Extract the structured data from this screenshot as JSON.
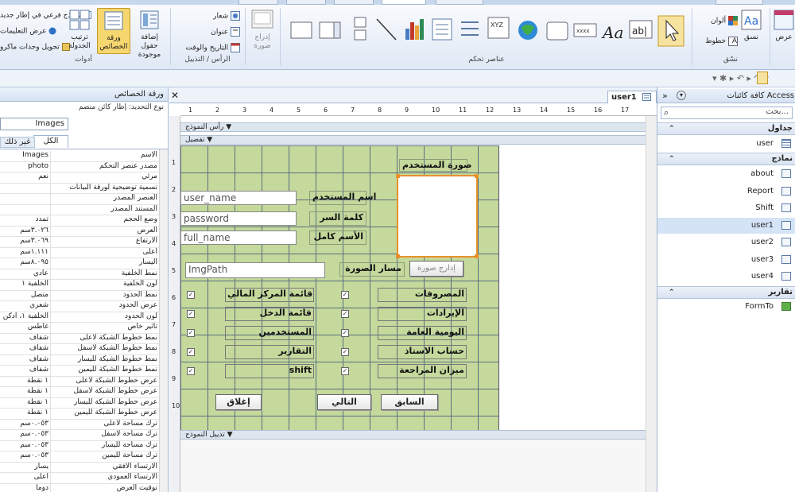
{
  "ribbon": {
    "groups": {
      "tools": "أدوات",
      "controls": "عناصر تحكم",
      "header_footer": "الرأس / التذييل",
      "format": "نسّق"
    },
    "buttons": {
      "subform_in_new_window": "نموذج فرعي في إطار جديد",
      "show_help": "عرض التعليمات",
      "convert_macros": "تحويل وحدات ماكرو",
      "tab_order": "ترتيب الجدولة",
      "property_sheet": "ورقة الخصائص",
      "add_existing_fields": "إضافة حقول موجودة",
      "logo": "شعار",
      "title": "عنوان",
      "date_time": "التاريخ والوقت",
      "insert_image": "إدراج صورة",
      "colors": "ألوان",
      "fonts": "خطوط",
      "themes": "نسق",
      "view": "عرض"
    },
    "active_color": "#f6d66e"
  },
  "properties": {
    "title": "ورقة الخصائص",
    "selection_type_label": "نوع التحديد: إطار كائن منضم",
    "selected_object": "Images",
    "tabs": [
      "الكل",
      "غير ذلك"
    ],
    "rows": [
      {
        "name": "الاسم",
        "value": "Images"
      },
      {
        "name": "مصدر عنصر التحكم",
        "value": "photo"
      },
      {
        "name": "مرئي",
        "value": "نعم"
      },
      {
        "name": "تسمية توضيحية لورقة البيانات",
        "value": ""
      },
      {
        "name": "العنصر المصدر",
        "value": ""
      },
      {
        "name": "المستند المصدر",
        "value": ""
      },
      {
        "name": "وضع الحجم",
        "value": "تمدد"
      },
      {
        "name": "العرض",
        "value": "٣.٠٢٦سم"
      },
      {
        "name": "الارتفاع",
        "value": "٣.٠٦٩سم"
      },
      {
        "name": "أعلى",
        "value": "١.١١١سم"
      },
      {
        "name": "اليسار",
        "value": "٨.٠٩٥سم"
      },
      {
        "name": "نمط الخلفية",
        "value": "عادي"
      },
      {
        "name": "لون الخلفية",
        "value": "الخلفية ١"
      },
      {
        "name": "نمط الحدود",
        "value": "متصل"
      },
      {
        "name": "عرض الحدود",
        "value": "شعري"
      },
      {
        "name": "لون الحدود",
        "value": "الخلفية ١، أدكن"
      },
      {
        "name": "تأثير خاص",
        "value": "غاطس"
      },
      {
        "name": "نمط خطوط الشبكة لأعلى",
        "value": "شفاف"
      },
      {
        "name": "نمط خطوط الشبكة لأسفل",
        "value": "شفاف"
      },
      {
        "name": "نمط خطوط الشبكة لليسار",
        "value": "شفاف"
      },
      {
        "name": "نمط خطوط الشبكة لليمين",
        "value": "شفاف"
      },
      {
        "name": "عرض خطوط الشبكة لأعلى",
        "value": "١ نقطة"
      },
      {
        "name": "عرض خطوط الشبكة لأسفل",
        "value": "١ نقطة"
      },
      {
        "name": "عرض خطوط الشبكة لليسار",
        "value": "١ نقطة"
      },
      {
        "name": "عرض خطوط الشبكة لليمين",
        "value": "١ نقطة"
      },
      {
        "name": "ترك مساحة لأعلى",
        "value": "٠.٠٥٣سم"
      },
      {
        "name": "ترك مساحة لأسفل",
        "value": "٠.٠٥٣سم"
      },
      {
        "name": "ترك مساحة لليسار",
        "value": "٠.٠٥٣سم"
      },
      {
        "name": "ترك مساحة لليمين",
        "value": "٠.٠٥٣سم"
      },
      {
        "name": "الارتساء الأفقي",
        "value": "يسار"
      },
      {
        "name": "الارتساء العمودي",
        "value": "أعلى"
      },
      {
        "name": "توقيت العرض",
        "value": "دوماً"
      }
    ]
  },
  "design": {
    "doc_tab": "user1",
    "sections": {
      "header": "رأس النموذج",
      "detail": "تفصيل",
      "footer": "تذييل النموذج"
    },
    "ruler_numbers": [
      "1",
      "2",
      "3",
      "4",
      "5",
      "6",
      "7",
      "8",
      "9",
      "10",
      "11",
      "12",
      "13",
      "14",
      "15",
      "16",
      "17"
    ],
    "vruler_numbers": [
      "1",
      "2",
      "3",
      "4",
      "5",
      "6",
      "7",
      "8",
      "9",
      "10"
    ],
    "form": {
      "image_label": "صورة المستخدم",
      "fields": [
        {
          "label": "اسم المستخدم",
          "value": "user_name"
        },
        {
          "label": "كلمة السر",
          "value": "password"
        },
        {
          "label": "الأسم كامل",
          "value": "full_name"
        }
      ],
      "imgpath_label": "مسار الصورة",
      "imgpath_value": "ImgPath",
      "insert_image_button": "إدارج صورة",
      "right_checks": [
        "المصروفات",
        "الإيرادات",
        "اليومية العامة",
        "حساب الاستاذ",
        "ميزان المراجعة"
      ],
      "left_checks": [
        "قائمة المركز المالي",
        "قائمة الدخل",
        "المستخدمين",
        "التقارير",
        "shift"
      ],
      "check_mark": "✓",
      "buttons": {
        "prev": "السابق",
        "next": "التالي",
        "close": "إغلاق"
      },
      "grid_color": "#c5d99c"
    }
  },
  "nav": {
    "title": "كافة كائنات Access",
    "search_placeholder": "بحث...",
    "groups": {
      "tables": "جداول",
      "forms": "نماذج",
      "reports": "تقارير"
    },
    "tables": [
      "user"
    ],
    "forms": [
      "about",
      "Report",
      "Shift",
      "user1",
      "user2",
      "user3",
      "user4"
    ],
    "reports": [
      "FormTo"
    ],
    "selected": "user1"
  }
}
